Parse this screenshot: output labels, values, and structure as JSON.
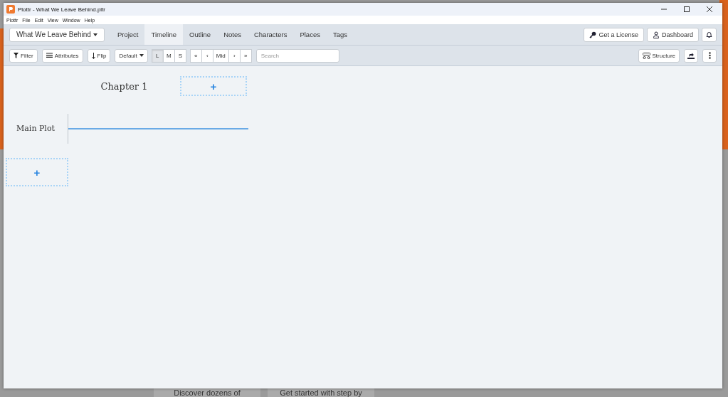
{
  "window": {
    "title": "Plottr - What We Leave Behind.pltr"
  },
  "menu": [
    "Plottr",
    "File",
    "Edit",
    "View",
    "Window",
    "Help"
  ],
  "project_button": {
    "label": "What We Leave Behind"
  },
  "tabs": [
    {
      "label": "Project",
      "selected": false
    },
    {
      "label": "Timeline",
      "selected": true
    },
    {
      "label": "Outline",
      "selected": false
    },
    {
      "label": "Notes",
      "selected": false
    },
    {
      "label": "Characters",
      "selected": false
    },
    {
      "label": "Places",
      "selected": false
    },
    {
      "label": "Tags",
      "selected": false
    }
  ],
  "header_buttons": [
    {
      "label": "Get a License",
      "kind": "key"
    },
    {
      "label": "Dashboard",
      "kind": "user"
    }
  ],
  "toolbar": {
    "filter": "Filter",
    "attributes": "Attributes",
    "flip": "Flip",
    "preset": "Default",
    "sizes": [
      {
        "label": "L",
        "selected": true
      },
      {
        "label": "M",
        "selected": false
      },
      {
        "label": "S",
        "selected": false
      }
    ],
    "navigation": [
      "«",
      "‹",
      "Mid",
      "›",
      "»"
    ],
    "search": {
      "placeholder": "Search"
    },
    "structure": "Structure"
  },
  "timeline": {
    "chapters": [
      "Chapter 1"
    ],
    "plotlines": [
      {
        "name": "Main Plot",
        "color": "#6aaae6"
      }
    ],
    "add_chapter": "+",
    "add_plotline": "+"
  },
  "background_cards": [
    "Discover dozens of",
    "Get started with step by"
  ]
}
